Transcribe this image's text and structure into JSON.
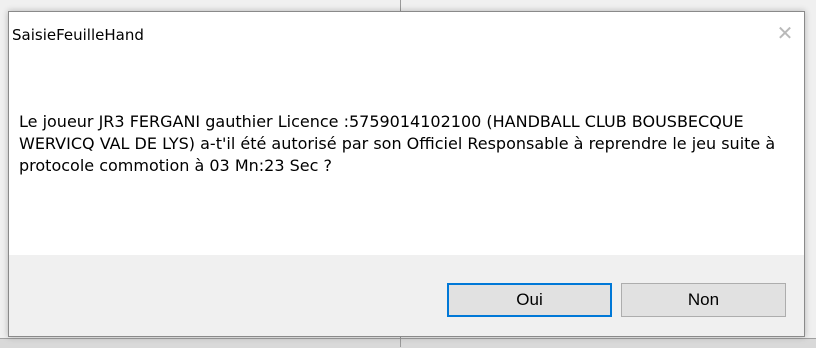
{
  "dialog": {
    "title": "SaisieFeuilleHand",
    "close_glyph": "✕",
    "message": "Le joueur  JR3 FERGANI gauthier Licence :5759014102100 (HANDBALL CLUB BOUSBECQUE WERVICQ VAL DE LYS) a-t'il été autorisé par son Officiel Responsable à reprendre le jeu suite à protocole commotion à 03 Mn:23 Sec ?",
    "buttons": {
      "yes_label": "Oui",
      "no_label": "Non"
    }
  },
  "colors": {
    "focus_border": "#0078d7",
    "button_bg": "#e1e1e1",
    "footer_bg": "#f0f0f0"
  }
}
